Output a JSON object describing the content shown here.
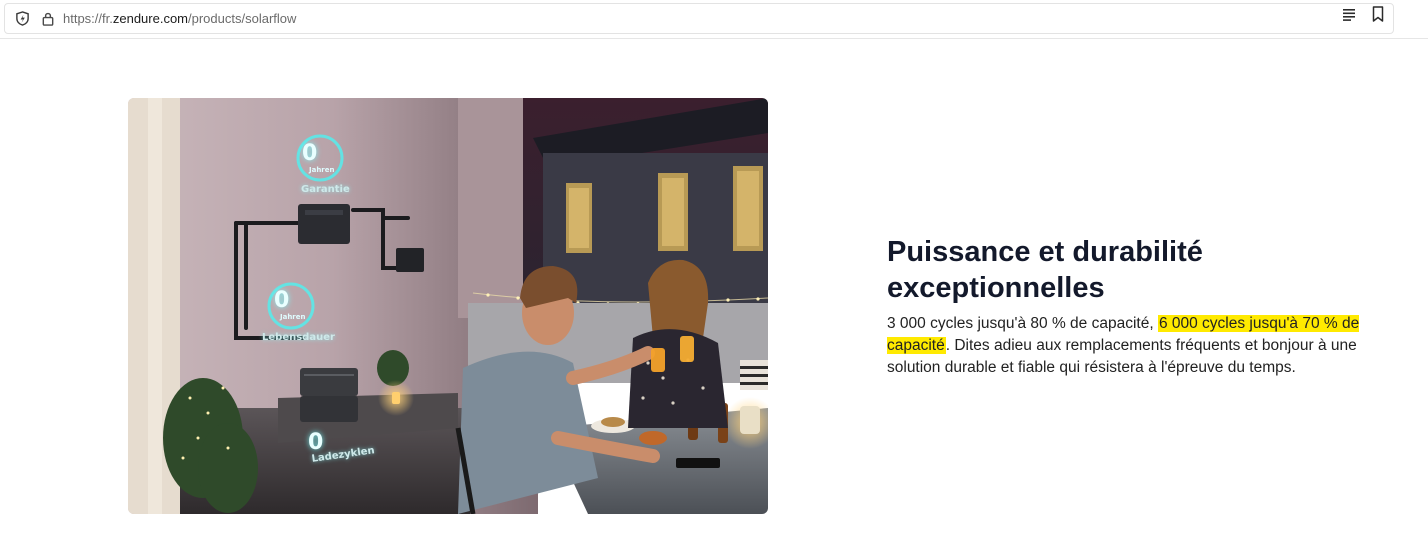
{
  "browser": {
    "url_prefix": "https://fr.",
    "url_domain": "zendure.com",
    "url_path": "/products/solarflow"
  },
  "hero": {
    "overlay_garantie_num": "0",
    "overlay_garantie_unit": "Jahren",
    "overlay_garantie_label": "Garantie",
    "overlay_lebensdauer_num": "0",
    "overlay_lebensdauer_unit": "Jahren",
    "overlay_lebensdauer_label": "Lebensdauer",
    "overlay_ladezyklen_num": "0",
    "overlay_ladezyklen_label": "Ladezyklen",
    "ring_color": "#5fe6e6"
  },
  "content": {
    "heading": "Puissance et durabilité exceptionnelles",
    "para_part1": "3 000 cycles jusqu'à 80 % de capacité, ",
    "para_highlight": "6 000 cycles jusqu'à 70 % de capacité",
    "para_part2": ". Dites adieu aux remplacements fréquents et bonjour à une solution durable et fiable qui résistera à l'épreuve du temps.",
    "highlight_color": "#ffea00"
  }
}
